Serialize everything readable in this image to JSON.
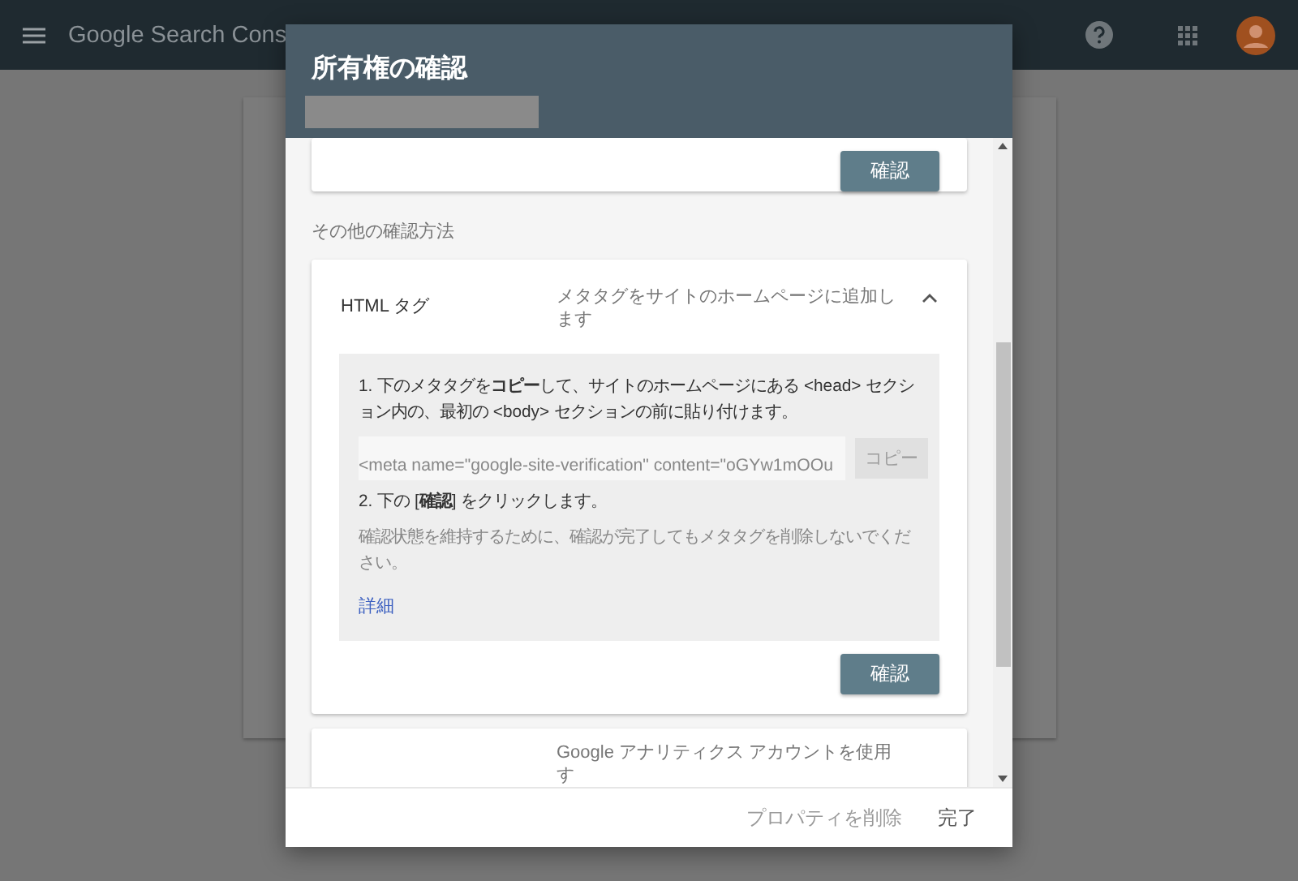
{
  "app_bar": {
    "title": "Google Search Cons"
  },
  "dialog": {
    "title": "所有権の確認",
    "top_card": {
      "button": "確認"
    },
    "section_label": "その他の確認方法",
    "methods": [
      {
        "name": "HTML タグ",
        "description": "メタタグをサイトのホームページに追加します",
        "expanded": true,
        "steps": [
          "1. 下のメタタグを**コピー**して、サイトのホームページにある <head> セクション内の、最初の <body> セクションの前に貼り付けます。",
          "2. 下の [**確認**] をクリックします。"
        ],
        "meta_tag": "<meta name=\"google-site-verification\" content=\"oGYw1mOOu",
        "copy_button": {
          "label": "コピー",
          "disabled": true
        },
        "note": "確認状態を維持するために、確認が完了してもメタタグを削除しないでください。",
        "link": "詳細",
        "button": "確認"
      },
      {
        "description": "Google アナリティクス アカウントを使用す"
      }
    ],
    "footer_buttons": [
      {
        "label": "プロパティを削除",
        "kind": "secondary"
      },
      {
        "label": "完了",
        "kind": "primary"
      }
    ]
  }
}
